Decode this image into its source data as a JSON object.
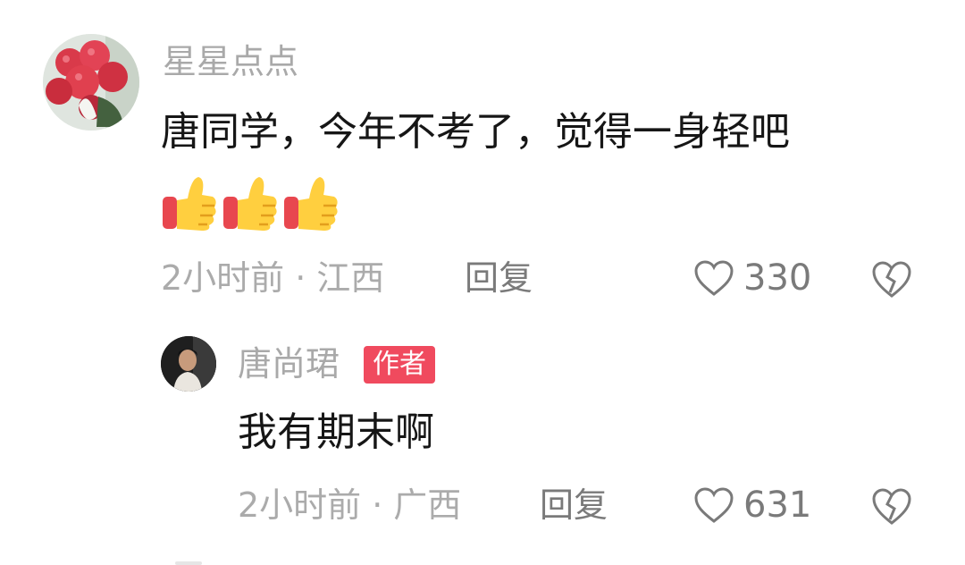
{
  "comments": [
    {
      "username": "星星点点",
      "content": "唐同学，今年不考了，觉得一身轻吧",
      "emojis": [
        "thumbs-up",
        "thumbs-up",
        "thumbs-up"
      ],
      "time": "2小时前",
      "location": "江西",
      "reply_label": "回复",
      "likes": "330"
    }
  ],
  "reply": {
    "username": "唐尚珺",
    "badge": "作者",
    "content": "我有期末啊",
    "time": "2小时前",
    "location": "广西",
    "reply_label": "回复",
    "likes": "631"
  },
  "separator": "·",
  "colors": {
    "username": "#a9a9a9",
    "content": "#161616",
    "meta": "#ababab",
    "action": "#7a7a7a",
    "author_badge": "#f04a5e"
  }
}
